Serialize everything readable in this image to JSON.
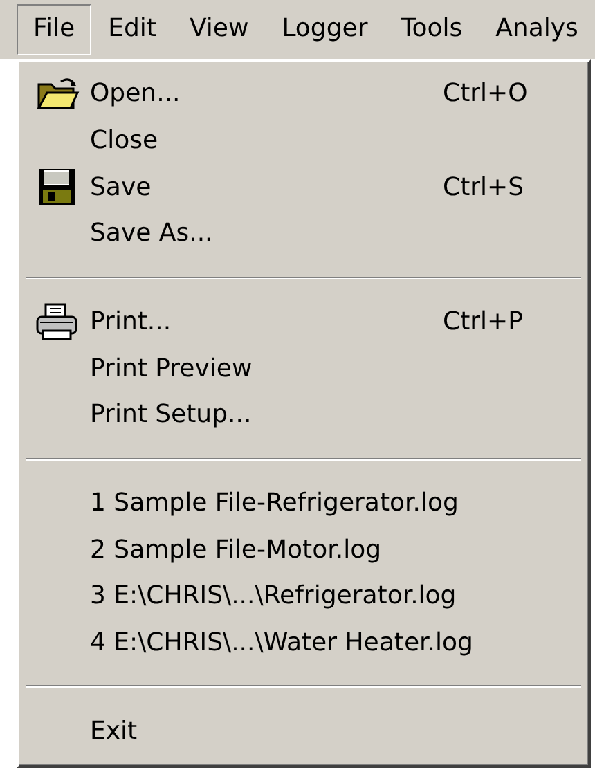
{
  "menu_bar": [
    {
      "label": "File",
      "selected": true
    },
    {
      "label": "Edit",
      "selected": false
    },
    {
      "label": "View",
      "selected": false
    },
    {
      "label": "Logger",
      "selected": false
    },
    {
      "label": "Tools",
      "selected": false
    },
    {
      "label": "Analys",
      "selected": false
    }
  ],
  "file_menu": [
    {
      "kind": "folder-item",
      "label": "Open...",
      "shortcut": "Ctrl+O"
    },
    {
      "kind": "item",
      "label": "Close"
    },
    {
      "kind": "floppy-item",
      "label": "Save",
      "shortcut": "Ctrl+S"
    },
    {
      "kind": "item",
      "label": "Save As..."
    },
    {
      "kind": "separator"
    },
    {
      "kind": "printer-item",
      "label": "Print...",
      "shortcut": "Ctrl+P"
    },
    {
      "kind": "item",
      "label": "Print Preview"
    },
    {
      "kind": "item",
      "label": "Print Setup..."
    },
    {
      "kind": "separator"
    },
    {
      "kind": "item",
      "label": "1 Sample File-Refrigerator.log"
    },
    {
      "kind": "item",
      "label": "2 Sample File-Motor.log"
    },
    {
      "kind": "item",
      "label": "3 E:\\CHRIS\\...\\Refrigerator.log"
    },
    {
      "kind": "item",
      "label": "4 E:\\CHRIS\\...\\Water Heater.log"
    },
    {
      "kind": "separator"
    },
    {
      "kind": "item",
      "label": "Exit"
    }
  ]
}
